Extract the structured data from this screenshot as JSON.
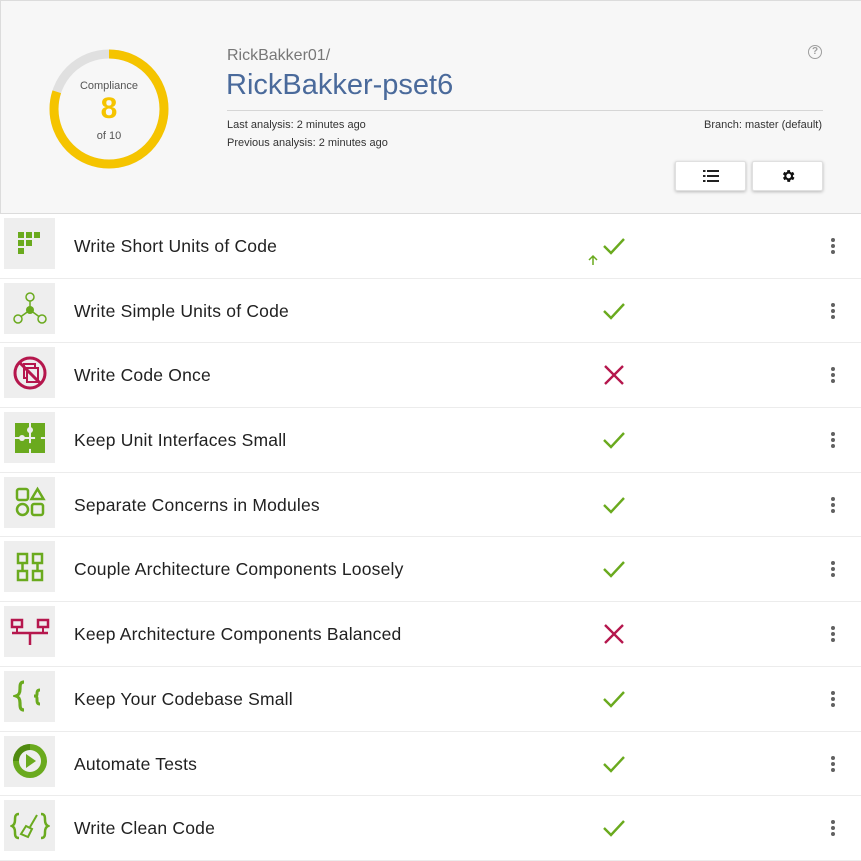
{
  "compliance": {
    "title": "Compliance",
    "score": "8",
    "max_label": "of 10",
    "fraction": 0.8,
    "gauge_color": "#f5c400"
  },
  "repo": {
    "owner": "RickBakker01/",
    "name": "RickBakker-pset6",
    "last_analysis": "Last analysis: 2 minutes ago",
    "previous_analysis": "Previous analysis: 2 minutes ago",
    "branch": "Branch: master (default)"
  },
  "help": {
    "icon": "help-icon",
    "glyph": "?"
  },
  "toolbar": {
    "list_icon": "list-icon",
    "settings_icon": "gear-icon"
  },
  "colors": {
    "pass": "#6aaa1e",
    "fail": "#b5174d",
    "repo_title": "#4a6a9b"
  },
  "guidelines": [
    {
      "title": "Write Short Units of Code",
      "icon": "short-units-icon",
      "status": "pass",
      "trend": "up"
    },
    {
      "title": "Write Simple Units of Code",
      "icon": "simple-units-icon",
      "status": "pass"
    },
    {
      "title": "Write Code Once",
      "icon": "code-once-icon",
      "status": "fail"
    },
    {
      "title": "Keep Unit Interfaces Small",
      "icon": "puzzle-icon",
      "status": "pass"
    },
    {
      "title": "Separate Concerns in Modules",
      "icon": "modules-icon",
      "status": "pass"
    },
    {
      "title": "Couple Architecture Components Loosely",
      "icon": "components-icon",
      "status": "pass"
    },
    {
      "title": "Keep Architecture Components Balanced",
      "icon": "balance-icon",
      "status": "fail"
    },
    {
      "title": "Keep Your Codebase Small",
      "icon": "braces-icon",
      "status": "pass"
    },
    {
      "title": "Automate Tests",
      "icon": "play-icon",
      "status": "pass"
    },
    {
      "title": "Write Clean Code",
      "icon": "broom-braces-icon",
      "status": "pass"
    }
  ]
}
